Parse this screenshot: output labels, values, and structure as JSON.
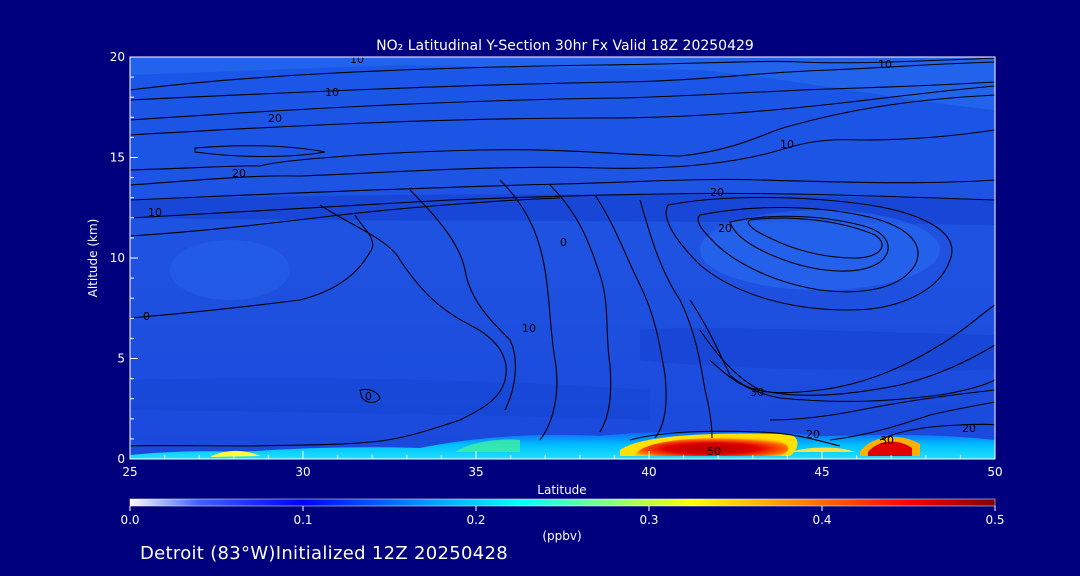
{
  "title": "NO₂ Latitudinal Y-Section 30hr  Fx Valid 18Z 20250429",
  "footer": "Detroit (83°W)Initialized 12Z 20250428",
  "chart_data": {
    "type": "heatmap",
    "title": "NO₂ Latitudinal Y-Section 30hr  Fx Valid 18Z 20250429",
    "xlabel": "Latitude",
    "ylabel": "Altitude (km)",
    "xlim": [
      25,
      50
    ],
    "ylim": [
      0,
      20
    ],
    "x_ticks": [
      25,
      30,
      35,
      40,
      45,
      50
    ],
    "y_ticks": [
      0,
      5,
      10,
      15,
      20
    ],
    "colorbar": {
      "label": "(ppbv)",
      "min": 0.0,
      "max": 0.5,
      "ticks": [
        "0.0",
        "0.1",
        "0.2",
        "0.3",
        "0.4",
        "0.5"
      ],
      "colors": [
        "#ffffff",
        "#0000ff",
        "#00bfff",
        "#00ffff",
        "#ffff00",
        "#ff8000",
        "#ff0000",
        "#800000"
      ]
    },
    "contour_labels": [
      "10",
      "10",
      "20",
      "20",
      "10",
      "0",
      "10",
      "20",
      "30",
      "20",
      "10",
      "0",
      "10",
      "20",
      "30",
      "20",
      "0",
      "50"
    ]
  }
}
